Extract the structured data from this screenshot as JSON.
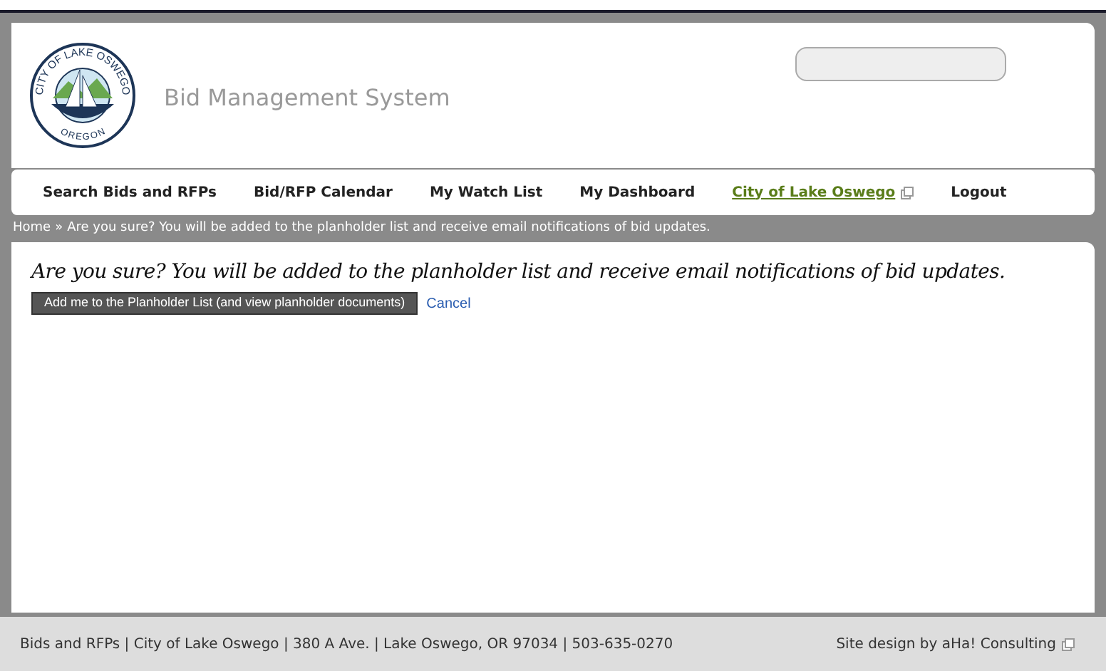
{
  "header": {
    "logo_text": {
      "top": "CITY OF LAKE OSWEGO",
      "bottom": "OREGON"
    },
    "title": "Bid Management System"
  },
  "nav": [
    {
      "label": "Search Bids and RFPs",
      "kind": "plain"
    },
    {
      "label": "Bid/RFP Calendar",
      "kind": "plain"
    },
    {
      "label": "My Watch List",
      "kind": "plain"
    },
    {
      "label": "My Dashboard",
      "kind": "plain"
    },
    {
      "label": "City of Lake Oswego",
      "kind": "external"
    },
    {
      "label": "Logout",
      "kind": "plain"
    }
  ],
  "breadcrumb": {
    "home": "Home",
    "separator": "»",
    "current": "Are you sure? You will be added to the planholder list and receive email notifications of bid updates."
  },
  "content": {
    "heading": "Are you sure? You will be added to the planholder list and receive email notifications of bid updates.",
    "confirm_button": "Add me to the Planholder List (and view planholder documents)",
    "cancel_link": "Cancel"
  },
  "footer": {
    "address": "Bids and RFPs | City of Lake Oswego | 380 A Ave. | Lake Oswego, OR 97034 | 503-635-0270",
    "credit": "Site design by aHa! Consulting"
  }
}
